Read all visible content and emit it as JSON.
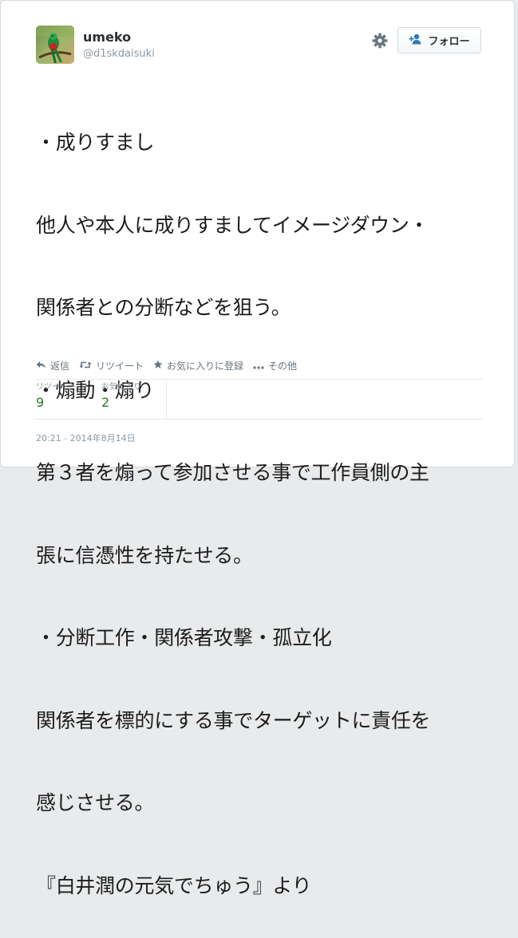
{
  "user": {
    "display_name": "umeko",
    "handle": "@d1skdaisuki",
    "avatar": "quetzal-bird-photo"
  },
  "header": {
    "settings_icon": "gear-icon",
    "follow_label": "フォロー",
    "follow_icon": "add-user-icon"
  },
  "tweet": {
    "text_lines": [
      "・成りすまし",
      "他人や本人に成りすましてイメージダウン・",
      "関係者との分断などを狙う。",
      "・煽動・煽り",
      "第３者を煽って参加させる事で工作員側の主",
      "張に信憑性を持たせる。",
      "・分断工作・関係者攻撃・孤立化",
      "関係者を標的にする事でターゲットに責任を",
      "感じさせる。",
      "『白井潤の元気でちゅう』より"
    ]
  },
  "actions": {
    "reply_label": "返信",
    "retweet_label": "リツイート",
    "favorite_label": "お気に入りに登録",
    "more_label": "その他"
  },
  "stats": {
    "retweets_label": "リツイート",
    "retweets_count": "9",
    "favorites_label": "お気に入り",
    "favorites_count": "2"
  },
  "meta": {
    "timestamp": "20:21 - 2014年8月14日"
  },
  "colors": {
    "text": "#1c1c1c",
    "muted": "#8899a6",
    "action": "#66757f",
    "count": "#2b7a2b",
    "border": "#e1e8ed"
  }
}
